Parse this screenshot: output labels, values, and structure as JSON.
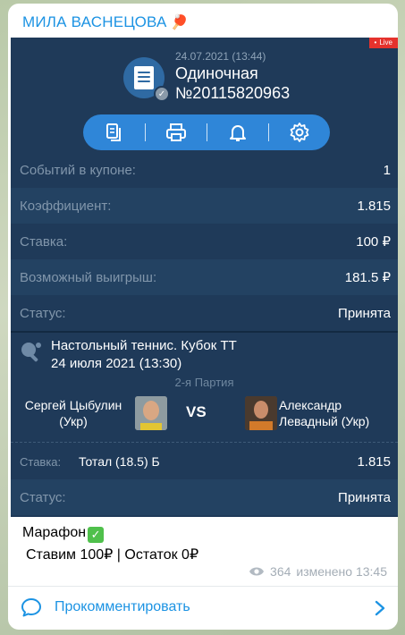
{
  "channel": {
    "title": "МИЛА ВАСНЕЦОВА",
    "emoji": "🏓"
  },
  "coupon": {
    "live_badge": "Live",
    "datetime": "24.07.2021 (13:44)",
    "type": "Одиночная",
    "number": "№20115820963",
    "icon": "coupon-icon"
  },
  "toolbar": {
    "icons": [
      "copy-icon",
      "print-icon",
      "bell-icon",
      "gear-icon"
    ]
  },
  "summary": [
    {
      "label": "Событий в купоне:",
      "value": "1"
    },
    {
      "label": "Коэффициент:",
      "value": "1.815"
    },
    {
      "label": "Ставка:",
      "value": "100 ₽"
    },
    {
      "label": "Возможный выигрыш:",
      "value": "181.5 ₽"
    },
    {
      "label": "Статус:",
      "value": "Принята"
    }
  ],
  "event": {
    "title": "Настольный теннис. Кубок ТТ",
    "date": "24 июля 2021 (13:30)",
    "stage": "2-я Партия",
    "player_left": "Сергей Цыбулин (Укр)",
    "player_right": "Александр Левадный (Укр)",
    "vs": "VS"
  },
  "bet": {
    "label": "Ставка:",
    "selection": "Тотал (18.5) Б",
    "odds": "1.815",
    "status_label": "Статус:",
    "status_value": "Принята"
  },
  "message": {
    "line1": "Марафон",
    "line2": "Ставим 100₽ | Остаток 0₽",
    "views": "364",
    "edited": "изменено 13:45"
  },
  "comment": {
    "label": "Прокомментировать"
  },
  "colors": {
    "accent": "#1c93e3",
    "panel": "#1f3a59",
    "toolbar": "#2f86d8",
    "live": "#e5322d",
    "check": "#4fc04b"
  }
}
